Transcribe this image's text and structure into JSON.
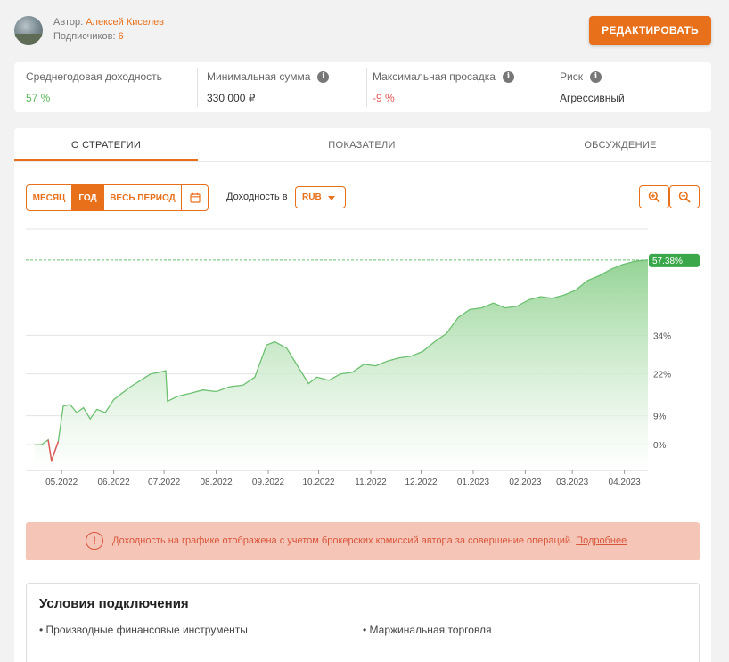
{
  "header": {
    "author_label": "Автор:",
    "author_name": "Алексей Киселев",
    "subscribers_label": "Подписчиков:",
    "subscribers_count": "6",
    "edit_button": "РЕДАКТИРОВАТЬ"
  },
  "stats": [
    {
      "label": "Среднегодовая доходность",
      "value": "57 %",
      "info": false,
      "color": "#5cb85c"
    },
    {
      "label": "Минимальная сумма",
      "value": "330 000 ₽",
      "info": true,
      "color": "#333333"
    },
    {
      "label": "Максимальная просадка",
      "value": "-9 %",
      "info": true,
      "color": "#e05a5a"
    },
    {
      "label": "Риск",
      "value": "Агрессивный",
      "info": true,
      "color": "#333333"
    }
  ],
  "tabs": [
    {
      "label": "О СТРАТЕГИИ",
      "active": true
    },
    {
      "label": "ПОКАЗАТЕЛИ",
      "active": false
    },
    {
      "label": "ОБСУЖДЕНИЕ",
      "active": false
    }
  ],
  "controls": {
    "period_buttons": [
      {
        "label": "МЕСЯЦ",
        "active": false
      },
      {
        "label": "ГОД",
        "active": true
      },
      {
        "label": "ВЕСЬ ПЕРИОД",
        "active": false
      }
    ],
    "calendar_icon": "calendar-icon",
    "yield_label": "Доходность в",
    "currency": "RUB",
    "zoom_in_icon": "zoom-in-icon",
    "zoom_out_icon": "zoom-out-icon"
  },
  "chart_data": {
    "type": "area",
    "x": [
      "2022-04-18",
      "2022-04-22",
      "2022-04-26",
      "2022-04-28",
      "2022-05-02",
      "2022-05-05",
      "2022-05-09",
      "2022-05-13",
      "2022-05-17",
      "2022-05-21",
      "2022-05-25",
      "2022-05-30",
      "2022-06-04",
      "2022-06-09",
      "2022-06-14",
      "2022-06-20",
      "2022-06-26",
      "2022-07-01",
      "2022-07-05",
      "2022-07-06",
      "2022-07-12",
      "2022-07-20",
      "2022-07-27",
      "2022-08-04",
      "2022-08-12",
      "2022-08-20",
      "2022-08-27",
      "2022-09-03",
      "2022-09-08",
      "2022-09-15",
      "2022-09-22",
      "2022-09-28",
      "2022-10-03",
      "2022-10-10",
      "2022-10-17",
      "2022-10-24",
      "2022-10-31",
      "2022-11-07",
      "2022-11-14",
      "2022-11-21",
      "2022-11-28",
      "2022-12-05",
      "2022-12-12",
      "2022-12-19",
      "2022-12-26",
      "2023-01-02",
      "2023-01-09",
      "2023-01-16",
      "2023-01-23",
      "2023-01-30",
      "2023-02-06",
      "2023-02-13",
      "2023-02-20",
      "2023-02-27",
      "2023-03-06",
      "2023-03-13",
      "2023-03-20",
      "2023-03-27",
      "2023-04-03",
      "2023-04-10",
      "2023-04-18"
    ],
    "y": [
      0,
      0,
      1.5,
      -5,
      1,
      12,
      12.5,
      10,
      11.5,
      8,
      11,
      10,
      14,
      16,
      18,
      20,
      22,
      22.5,
      23,
      13.5,
      15,
      16,
      17,
      16.5,
      18,
      18.5,
      21,
      31,
      32,
      30,
      24,
      19,
      21,
      20,
      22,
      22.5,
      25,
      24.5,
      26,
      27,
      27.5,
      29,
      32,
      34.5,
      39.5,
      42,
      42.5,
      44,
      42.5,
      43,
      45,
      46,
      45.5,
      46.5,
      48,
      51,
      52.5,
      54.5,
      56,
      57,
      57.38
    ],
    "y_ticks": [
      "0%",
      "9%",
      "22%",
      "34%"
    ],
    "y_tick_values": [
      0,
      9,
      22,
      34
    ],
    "x_ticks": [
      "05.2022",
      "06.2022",
      "07.2022",
      "08.2022",
      "09.2022",
      "10.2022",
      "11.2022",
      "12.2022",
      "01.2023",
      "02.2023",
      "03.2023",
      "04.2023"
    ],
    "x_tick_values": [
      "2022-05-04",
      "2022-06-04",
      "2022-07-04",
      "2022-08-04",
      "2022-09-04",
      "2022-10-04",
      "2022-11-04",
      "2022-12-04",
      "2023-01-04",
      "2023-02-04",
      "2023-03-04",
      "2023-04-04"
    ],
    "ylim": [
      -8,
      64
    ],
    "last_value_label": "57.38%",
    "grid": true,
    "colors": {
      "line": "#6cc070",
      "fill_top": "#8fd18f",
      "fill_bottom": "#ffffff",
      "negative": "#e05a5a",
      "badge": "#3aa84a"
    }
  },
  "notice": {
    "text": "Доходность на графике отображена с учетом брокерских комиссий автора за совершение операций.",
    "link": "Подробнее",
    "icon": "warning-circle-icon"
  },
  "conditions": {
    "title": "Условия подключения",
    "items": [
      "Производные финансовые инструменты",
      "Маржинальная торговля"
    ]
  }
}
